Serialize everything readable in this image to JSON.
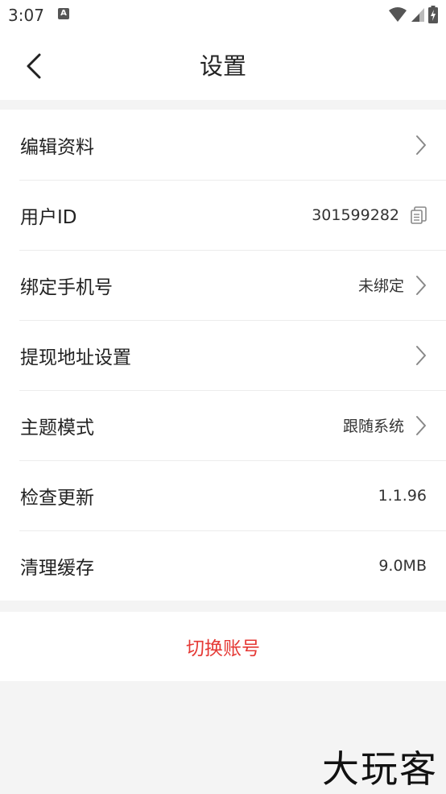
{
  "status_bar": {
    "time": "3:07",
    "notification_glyph": "A"
  },
  "nav": {
    "title": "设置"
  },
  "rows": [
    {
      "label": "编辑资料",
      "value": ""
    },
    {
      "label": "用户ID",
      "value": "301599282"
    },
    {
      "label": "绑定手机号",
      "value": "未绑定"
    },
    {
      "label": "提现地址设置",
      "value": ""
    },
    {
      "label": "主题模式",
      "value": "跟随系统"
    },
    {
      "label": "检查更新",
      "value": "1.1.96"
    },
    {
      "label": "清理缓存",
      "value": "9.0MB"
    }
  ],
  "switch_account": {
    "label": "切换账号"
  },
  "brand": {
    "watermark": "大玩客"
  },
  "colors": {
    "accent_red": "#e53935",
    "background": "#f4f4f4"
  },
  "icons": {
    "back": "chevron-left-icon",
    "disclosure": "chevron-right-icon",
    "copy": "copy-icon"
  }
}
